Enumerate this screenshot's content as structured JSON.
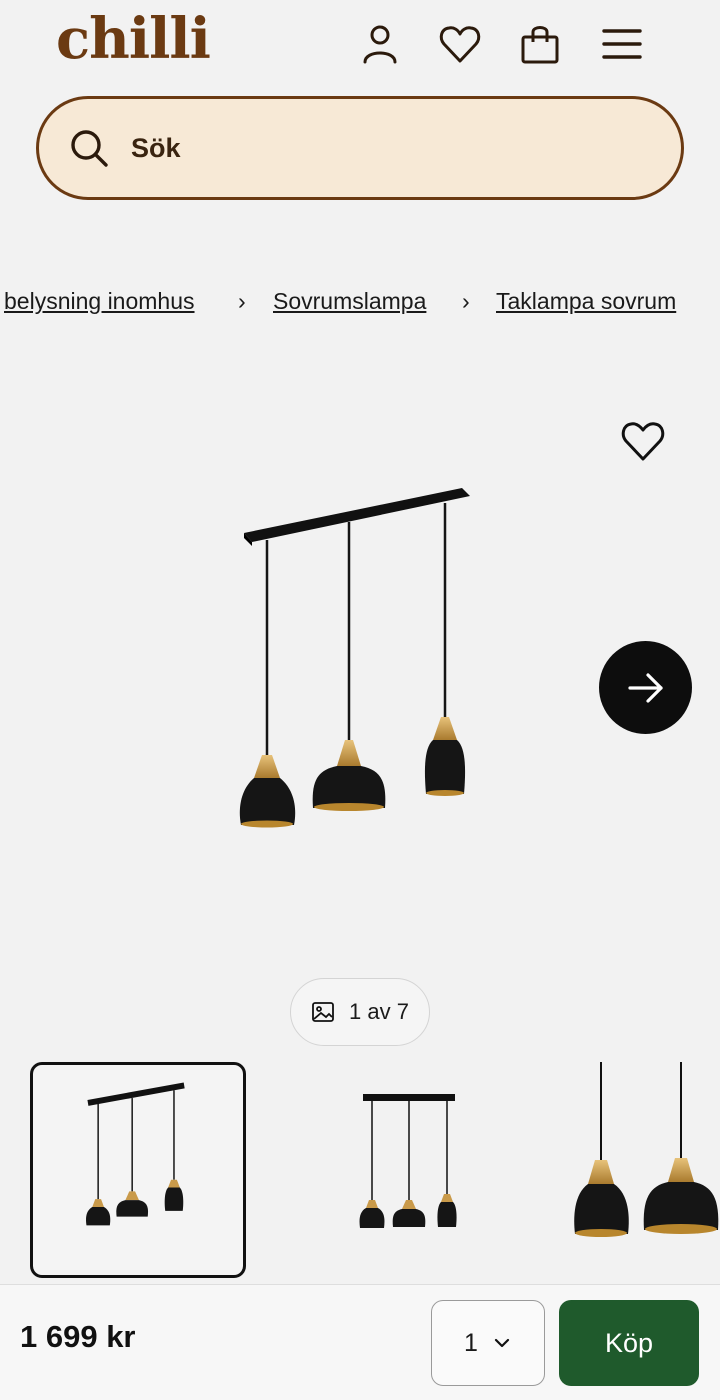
{
  "header": {
    "logo": "chilli",
    "icons": [
      "user-icon",
      "heart-icon",
      "shopping-bag-icon",
      "menu-icon"
    ]
  },
  "search": {
    "placeholder": "Sök"
  },
  "breadcrumb": {
    "items": [
      "belysning inomhus",
      "Sovrumslampa",
      "Taklampa sovrum"
    ],
    "separator": "›"
  },
  "gallery": {
    "counter": "1 av 7"
  },
  "purchase": {
    "price": "1 699 kr",
    "quantity": "1",
    "buy_label": "Köp"
  },
  "colors": {
    "brand": "#6b3a12",
    "search_bg": "#f7e9d6",
    "buy_button": "#1f5a2c",
    "next_button": "#0d0d0d"
  }
}
